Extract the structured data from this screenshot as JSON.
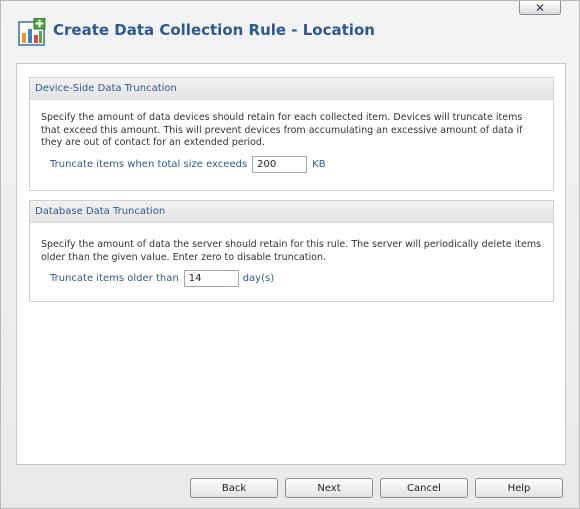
{
  "window": {
    "title": "Create Data Collection Rule - Location",
    "close_glyph": "✕",
    "icon": "chart-add-icon"
  },
  "sections": [
    {
      "header": "Device-Side Data Truncation",
      "description": "Specify the amount of data devices should retain for each collected item. Devices will truncate items that exceed this amount. This will prevent devices from accumulating an excessive amount of data if they are out of contact for an extended period.",
      "field_label": "Truncate items when total size exceeds",
      "field_value": "200",
      "field_unit": "KB"
    },
    {
      "header": "Database Data Truncation",
      "description": "Specify the amount of data the server should retain for this rule. The server will periodically delete items older than the given value. Enter zero to disable truncation.",
      "field_label": "Truncate items older than",
      "field_value": "14",
      "field_unit": "day(s)"
    }
  ],
  "buttons": {
    "back": "Back",
    "next": "Next",
    "cancel": "Cancel",
    "help": "Help"
  },
  "colors": {
    "accent": "#2c5a8f",
    "dialog_background": "#f0f0f0"
  }
}
